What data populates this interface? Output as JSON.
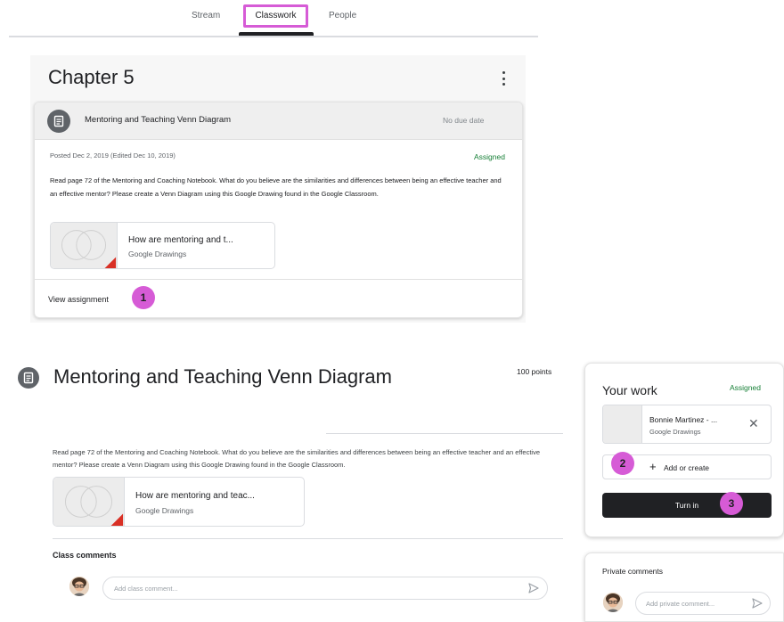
{
  "nav": {
    "tabs": [
      {
        "label": "Stream"
      },
      {
        "label": "Classwork"
      },
      {
        "label": "People"
      }
    ]
  },
  "topic": {
    "title": "Chapter 5",
    "menu_icon": "more-vert-icon"
  },
  "assignment_card": {
    "icon": "assignment-icon",
    "title": "Mentoring and Teaching Venn Diagram",
    "due": "No due date",
    "posted": "Posted Dec 2, 2019 (Edited Dec 10, 2019)",
    "status": "Assigned",
    "description": "Read page 72 of the Mentoring and Coaching Notebook. What do you believe are the similarities and differences between being an effective teacher and an effective mentor? Please create a Venn Diagram using this Google Drawing found in the Google Classroom.",
    "attachment": {
      "title": "How are mentoring and t...",
      "type": "Google Drawings"
    },
    "view_link": "View assignment"
  },
  "detail": {
    "icon": "assignment-icon",
    "title": "Mentoring and Teaching Venn Diagram",
    "points": "100 points",
    "description": "Read page 72 of the Mentoring and Coaching Notebook. What do you believe are the similarities and differences between being an effective teacher and an effective mentor? Please create a Venn Diagram using this Google Drawing found in the Google Classroom.",
    "attachment": {
      "title": "How are mentoring and teac...",
      "type": "Google Drawings"
    },
    "class_comments_label": "Class comments",
    "class_comment_placeholder": "Add class comment..."
  },
  "your_work": {
    "title": "Your work",
    "status": "Assigned",
    "file": {
      "name": "Bonnie Martinez - ...",
      "type": "Google Drawings"
    },
    "add_label": "Add or create",
    "turn_in_label": "Turn in"
  },
  "private_comments": {
    "title": "Private comments",
    "placeholder": "Add private comment..."
  },
  "badges": [
    "1",
    "2",
    "3"
  ],
  "colors": {
    "highlight": "#d65bd6",
    "assigned_green": "#188038",
    "turn_in_bg": "#202124",
    "icon_gray": "#5f6368"
  }
}
